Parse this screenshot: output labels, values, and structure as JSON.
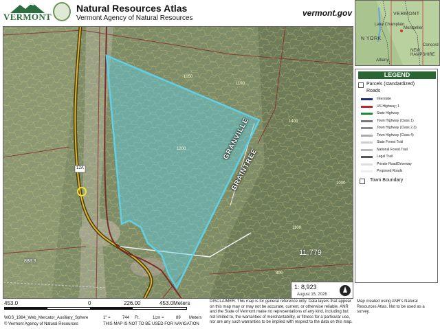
{
  "header": {
    "state_name": "VERMONT",
    "title": "Natural Resources Atlas",
    "subtitle": "Vermont Agency of Natural Resources",
    "url": "vermont.gov"
  },
  "map": {
    "contour_labels": [
      "1050",
      "1200",
      "1100",
      "1400",
      "1000",
      "1100",
      "800"
    ],
    "road_labels": {
      "granville": "GRANVILLE",
      "braintree": "BRAINTREE"
    },
    "route_shield": "12A",
    "elevation_label": "11,779",
    "feature_label": "888.3",
    "scale_text": "1: 8,923",
    "date": "August 15, 2026",
    "highlight_color": "#5fd0e8"
  },
  "inset": {
    "labels": {
      "vermont": "VERMONT",
      "lake": "Lake Champlain",
      "montpelier": "Montpelier",
      "new_york": "N YORK",
      "albany": "Albany",
      "new_hampshire": "NEW HAMPSHIRE",
      "concord": "Concord"
    }
  },
  "legend": {
    "title": "LEGEND",
    "parcels": "Parcels (standardized)",
    "roads": "Roads",
    "road_items": [
      {
        "label": "Interstate",
        "color": "#1d2a7a"
      },
      {
        "label": "US Highway; 1",
        "color": "#c0212b"
      },
      {
        "label": "State Highway",
        "color": "#1d8a3a"
      },
      {
        "label": "Town Highway (Class 1)",
        "color": "#777777"
      },
      {
        "label": "Town Highway (Class 2,3)",
        "color": "#888888"
      },
      {
        "label": "Town Highway (Class 4)",
        "color": "#aaaaaa"
      },
      {
        "label": "State Forest Trail",
        "color": "#cccccc"
      },
      {
        "label": "National Forest Trail",
        "color": "#bbbbbb"
      },
      {
        "label": "Legal Trail",
        "color": "#555555"
      },
      {
        "label": "Private Road/Driveway",
        "color": "#dddddd"
      },
      {
        "label": "Proposed Roads",
        "color": "#eeeeee"
      }
    ],
    "town_boundary": "Town Boundary"
  },
  "scalebar": {
    "labels": [
      "453.0",
      "0",
      "226.00",
      "453.0Meters"
    ],
    "projection": "WGS_1984_Web_Mercator_Auxiliary_Sphere",
    "copyright": "© Vermont Agency of Natural Resources",
    "ratio_inch": "1\" =",
    "ratio_inch_value": "744",
    "ratio_inch_unit": "Ft.",
    "ratio_cm": "1cm =",
    "ratio_cm_value": "89",
    "ratio_cm_unit": "Meters",
    "nav_warning": "THIS MAP IS NOT TO BE USED FOR NAVIGATION"
  },
  "disclaimer": "DISCLAIMER: This map is for general reference only. Data layers that appear on this map may or may not be accurate, current, or otherwise reliable. ANR and the State of Vermont make no representations of any kind, including but not limited to, the warranties of merchantability, or fitness for a particular use, nor are any such warranties to be implied with respect to the data on this map.",
  "credit": "Map created using ANR's Natural Resources Atlas. Not to be used as a survey."
}
